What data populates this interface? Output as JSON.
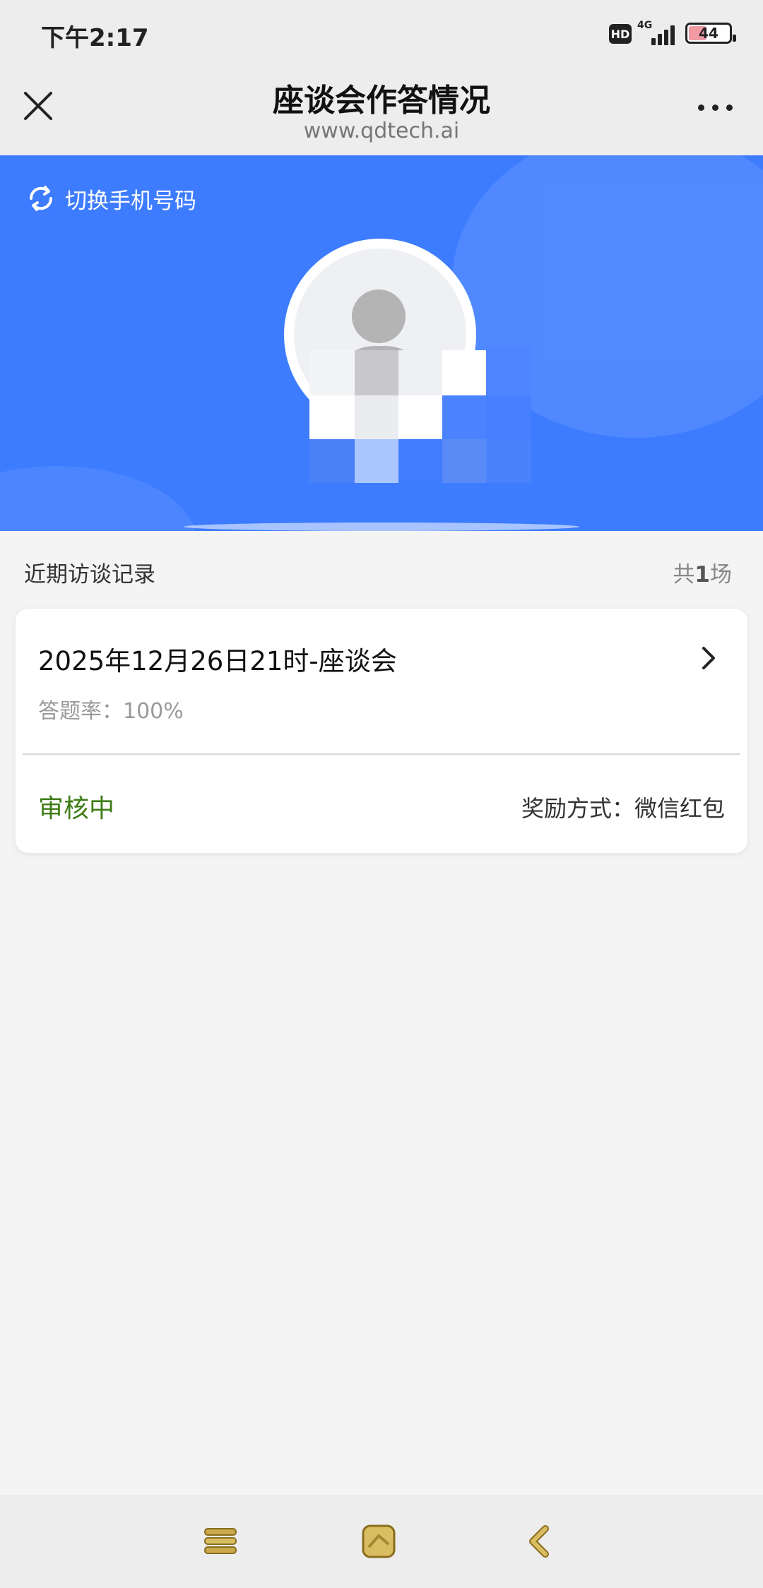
{
  "status_bar": {
    "time": "下午2:17",
    "hd": "HD",
    "network": "4G",
    "battery": "44",
    "battery_level": 0.44
  },
  "nav": {
    "title": "座谈会作答情况",
    "url": "www.qdtech.ai",
    "close_icon": "close-icon",
    "more_icon": "more-icon"
  },
  "hero": {
    "switch_label": "切换手机号码",
    "switch_icon": "refresh-icon",
    "background_color": "#3d7cff"
  },
  "records": {
    "section_title": "近期访谈记录",
    "count_prefix": "共",
    "count_value": "1",
    "count_suffix": "场",
    "items": [
      {
        "title": "2025年12月26日21时-座谈会",
        "rate": "答题率：100%",
        "status": "审核中",
        "reward": "奖励方式：微信红包"
      }
    ]
  },
  "colors": {
    "status_green": "#3e7d16",
    "brand_blue": "#3d7cff"
  },
  "bottom_nav": {
    "items": [
      "menu-icon",
      "home-icon",
      "back-icon"
    ]
  }
}
